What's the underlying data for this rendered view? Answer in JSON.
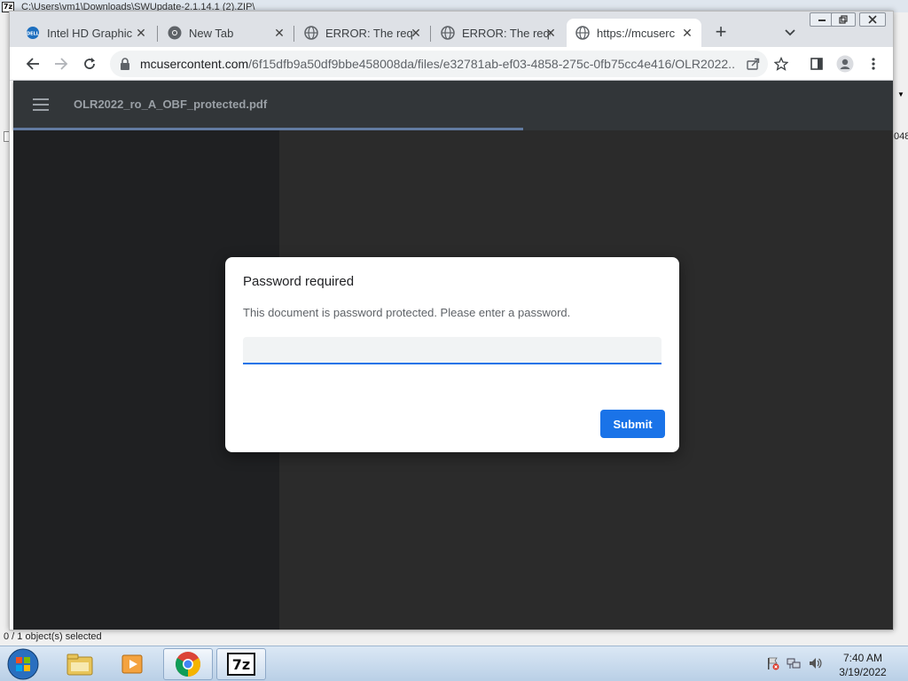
{
  "background_window": {
    "title": "C:\\Users\\vm1\\Downloads\\SWUpdate-2.1.14.1 (2).ZIP\\",
    "right_column_text": "048",
    "status_text": "0 / 1 object(s) selected"
  },
  "browser": {
    "tabs": [
      {
        "title": "Intel HD Graphic",
        "icon": "dell-icon",
        "active": false
      },
      {
        "title": "New Tab",
        "icon": "chrome-icon",
        "active": false
      },
      {
        "title": "ERROR: The requ",
        "icon": "globe-icon",
        "active": false
      },
      {
        "title": "ERROR: The requ",
        "icon": "globe-icon",
        "active": false
      },
      {
        "title": "https://mcuserc",
        "icon": "globe-icon",
        "active": true
      }
    ],
    "url_host": "mcusercontent.com",
    "url_path": "/6f15dfb9a50df9bbe458008da/files/e32781ab-ef03-4858-275c-0fb75cc4e416/OLR2022..."
  },
  "pdf_viewer": {
    "file_name": "OLR2022_ro_A_OBF_protected.pdf"
  },
  "dialog": {
    "title": "Password required",
    "message": "This document is password protected. Please enter a password.",
    "input_value": "",
    "submit_label": "Submit"
  },
  "taskbar": {
    "time": "7:40 AM",
    "date": "3/19/2022",
    "apps": [
      "file-explorer-icon",
      "media-player-icon",
      "chrome-icon",
      "7zip-icon"
    ]
  },
  "colors": {
    "accent": "#1a73e8",
    "viewer_bg": "#2b2b2b",
    "sidebar_bg": "#1f2022",
    "header_bg": "#323639"
  }
}
